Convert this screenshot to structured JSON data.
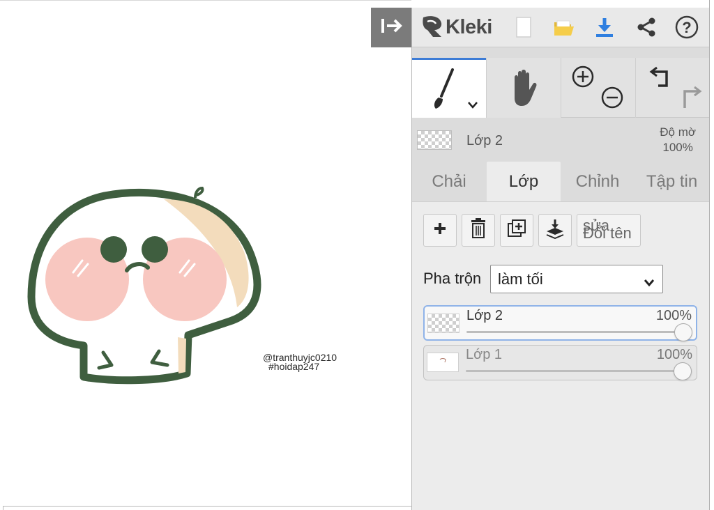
{
  "app": {
    "name": "Kleki",
    "brand_color": "#4a4a4a",
    "accent_color": "#3d7cd6"
  },
  "canvas": {
    "watermark_line1": "@tranthuyjc0210",
    "watermark_line2": "#hoidap247",
    "collapse_icon": "arrow-right-bar-icon"
  },
  "topbar": {
    "icons": [
      "new-file-icon",
      "open-folder-icon",
      "download-icon",
      "share-icon",
      "help-icon"
    ]
  },
  "tools": {
    "brush_icon": "brush-icon",
    "hand_icon": "hand-icon",
    "zoom_in_icon": "zoom-in-icon",
    "zoom_out_icon": "zoom-out-icon",
    "undo_icon": "undo-icon",
    "redo_icon": "redo-icon"
  },
  "current_layer": {
    "name": "Lớp 2",
    "opacity_label": "Độ mờ",
    "opacity_value": "100%"
  },
  "tabs": [
    {
      "label": "Chải",
      "active": false
    },
    {
      "label": "Lớp",
      "active": true
    },
    {
      "label": "Chỉnh",
      "active": false
    },
    {
      "label": "Tập tin",
      "active": false
    }
  ],
  "layer_actions": {
    "icons": [
      "add-layer-icon",
      "delete-layer-icon",
      "duplicate-layer-icon",
      "merge-down-icon"
    ],
    "rename_label_top": "sửa",
    "rename_label_bottom": "Đổi tên"
  },
  "blend": {
    "label": "Pha trộn",
    "selected": "làm tối"
  },
  "layers": [
    {
      "name": "Lớp 2",
      "opacity": "100%",
      "opacity_fraction": 1.0,
      "selected": true
    },
    {
      "name": "Lớp 1",
      "opacity": "100%",
      "opacity_fraction": 1.0,
      "selected": false
    }
  ]
}
